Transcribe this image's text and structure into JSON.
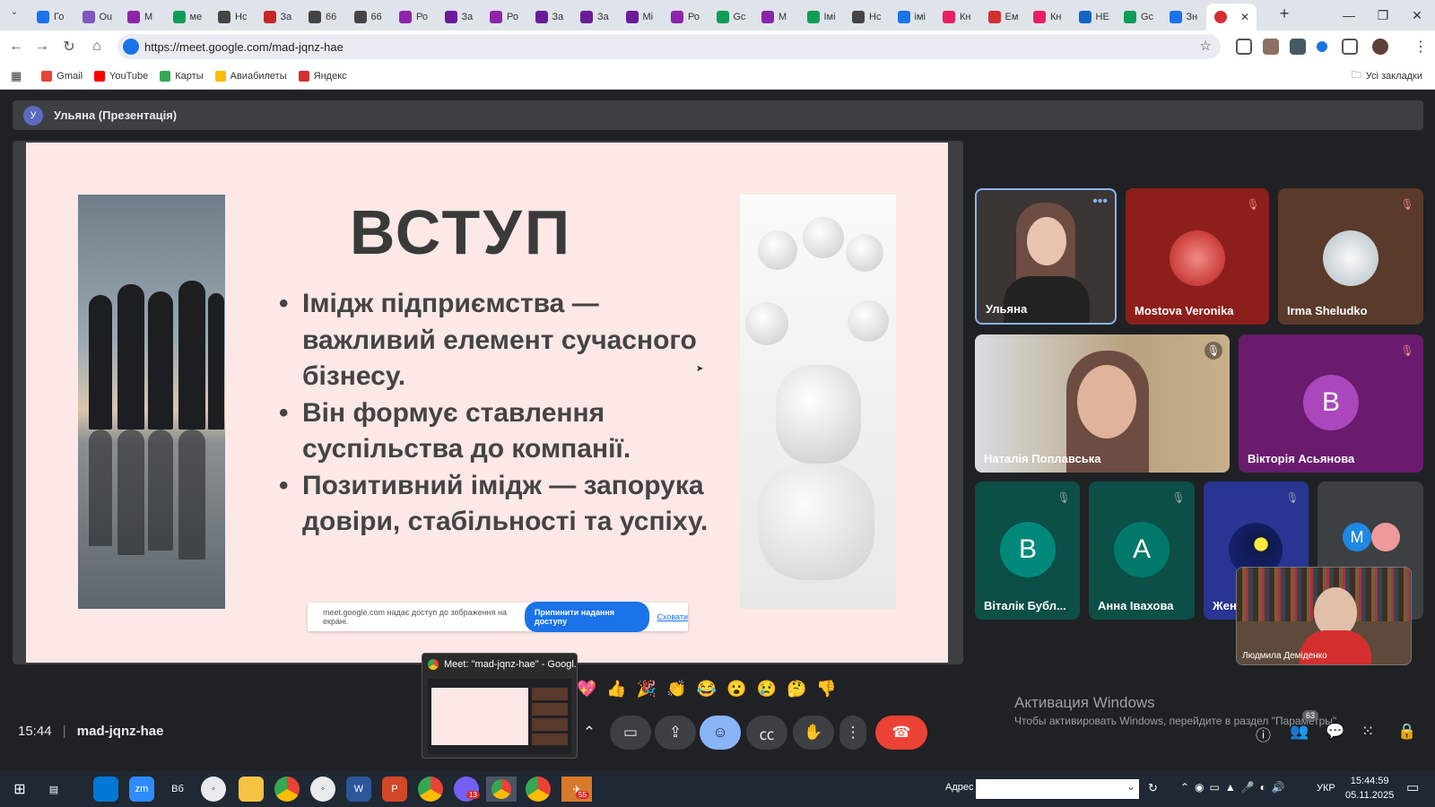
{
  "browser": {
    "tabs": [
      {
        "label": "Го",
        "color": "#1a73e8"
      },
      {
        "label": "Ou",
        "color": "#7e57c2"
      },
      {
        "label": "М",
        "color": "#8e24aa"
      },
      {
        "label": "ме",
        "color": "#0f9d58"
      },
      {
        "label": "Нс",
        "color": "#444"
      },
      {
        "label": "За",
        "color": "#c62828"
      },
      {
        "label": "66",
        "color": "#444"
      },
      {
        "label": "66",
        "color": "#444"
      },
      {
        "label": "Ро",
        "color": "#8e24aa"
      },
      {
        "label": "За",
        "color": "#6a1b9a"
      },
      {
        "label": "Ро",
        "color": "#8e24aa"
      },
      {
        "label": "За",
        "color": "#6a1b9a"
      },
      {
        "label": "За",
        "color": "#6a1b9a"
      },
      {
        "label": "Мі",
        "color": "#6a1b9a"
      },
      {
        "label": "Ро",
        "color": "#8e24aa"
      },
      {
        "label": "Gc",
        "color": "#0f9d58"
      },
      {
        "label": "М",
        "color": "#8e24aa"
      },
      {
        "label": "Імі",
        "color": "#0f9d58"
      },
      {
        "label": "Нс",
        "color": "#444"
      },
      {
        "label": "імі",
        "color": "#1a73e8"
      },
      {
        "label": "Кн",
        "color": "#e91e63"
      },
      {
        "label": "Ем",
        "color": "#d32f2f"
      },
      {
        "label": "Кн",
        "color": "#e91e63"
      },
      {
        "label": "НЕ",
        "color": "#1565c0"
      },
      {
        "label": "Gc",
        "color": "#0f9d58"
      },
      {
        "label": "Зн",
        "color": "#1a73e8"
      }
    ],
    "active_tab_close": "✕",
    "new_tab": "+",
    "url": "https://meet.google.com/mad-jqnz-hae",
    "bookmarks": [
      {
        "label": "Gmail",
        "color": "#ea4335"
      },
      {
        "label": "YouTube",
        "color": "#ff0000"
      },
      {
        "label": "Карты",
        "color": "#34a853"
      },
      {
        "label": "Авиабилеты",
        "color": "#fbbc04"
      },
      {
        "label": "Яндекс",
        "color": "#d32f2f"
      }
    ],
    "all_bookmarks": "Усі закладки"
  },
  "meet": {
    "presenter_initial": "У",
    "presenter_label": "Ульяна (Презентація)",
    "slide": {
      "title": "ВСТУП",
      "bullets": [
        "Імідж підприємства — важливий елемент сучасного бізнесу.",
        "Він формує ставлення суспільства до компанії.",
        "Позитивний імідж — запорука довіри, стабільності та успіху."
      ]
    },
    "share_notice": {
      "text": "meet.google.com надає доступ до зображення на екрані.",
      "stop_label": "Припинити надання доступу",
      "hide_label": "Сховати"
    },
    "participants": [
      {
        "name": "Ульяна",
        "type": "video"
      },
      {
        "name": "Mostova Veronika",
        "type": "photo",
        "muted": true
      },
      {
        "name": "Irma Sheludko",
        "type": "photo",
        "muted": true
      },
      {
        "name": "Наталія Поплавська",
        "type": "video",
        "muted": true
      },
      {
        "name": "Вікторія Асьянова",
        "initial": "В",
        "color": "#ab47bc",
        "bg": "#6a1b6e",
        "muted": true
      },
      {
        "name": "Віталік Бубл...",
        "initial": "В",
        "color": "#00897b",
        "bg": "#0b4f47",
        "muted": true
      },
      {
        "name": "Анна Івахова",
        "initial": "А",
        "color": "#00796b",
        "bg": "#0b4f47",
        "muted": true
      },
      {
        "name": "Жен",
        "type": "photo",
        "muted": true
      },
      {
        "name": "Людмила Деміденко",
        "type": "video"
      }
    ],
    "more_initial": "M",
    "time": "15:44",
    "meeting_code": "mad-jqnz-hae",
    "reactions": [
      "💖",
      "👍",
      "🎉",
      "👏",
      "😂",
      "😮",
      "😢",
      "🤔",
      "👎"
    ],
    "preview_title": "Meet: \"mad-jqnz-hae\" - Googl...",
    "participant_count": "63",
    "watermark_title": "Активация Windows",
    "watermark_sub": "Чтобы активировать Windows, перейдите в раздел \"Параметры\"."
  },
  "taskbar": {
    "address_label": "Адрес",
    "lang": "УКР",
    "time": "15:44:59",
    "date": "05.11.2025",
    "badge_viber": "13",
    "badge_telegram": "55"
  }
}
